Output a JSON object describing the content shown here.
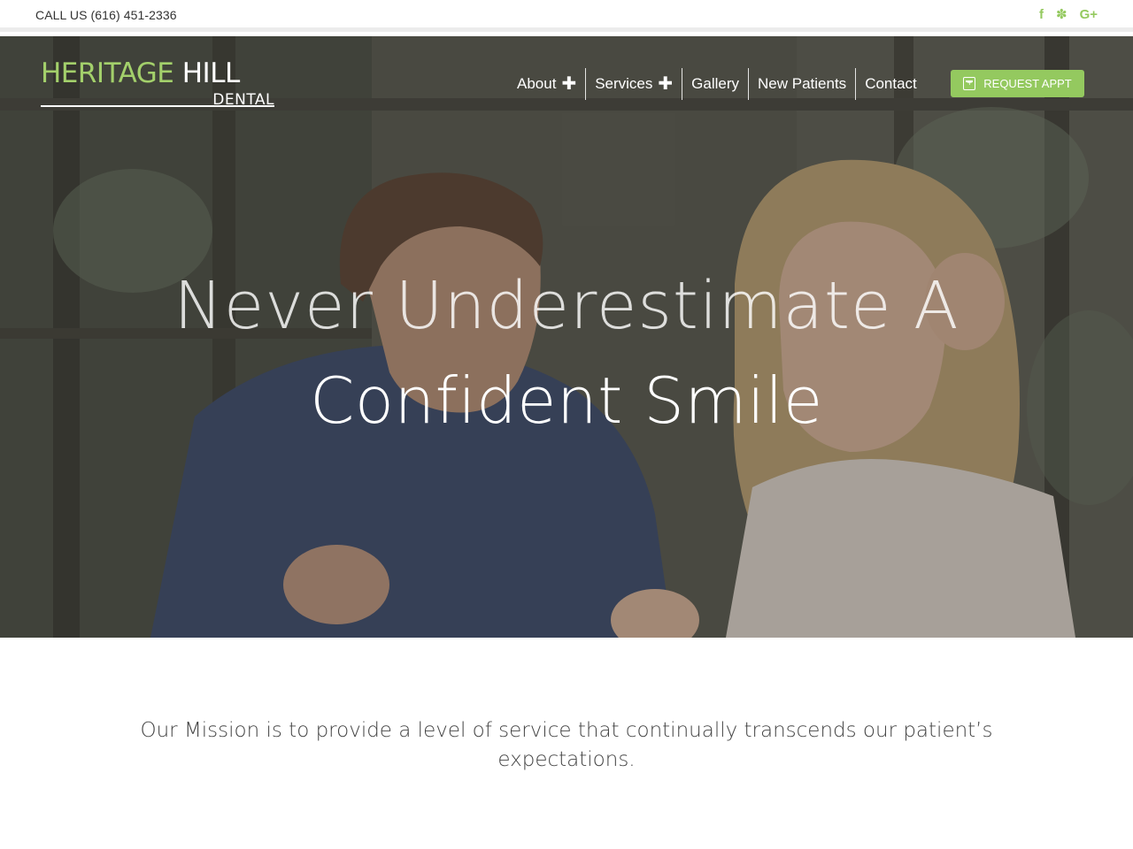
{
  "topbar": {
    "phone": "CALL US (616) 451-2336",
    "social": [
      {
        "icon": "facebook-icon",
        "glyph": "f"
      },
      {
        "icon": "yelp-icon",
        "glyph": "✽"
      },
      {
        "icon": "google-plus-icon",
        "glyph": "G+"
      }
    ]
  },
  "logo": {
    "word1": "HERITAGE",
    "word2": "HILL",
    "sub": "DENTAL"
  },
  "nav": {
    "items": [
      {
        "label": "About",
        "has_submenu": true
      },
      {
        "label": "Services",
        "has_submenu": true
      },
      {
        "label": "Gallery",
        "has_submenu": false
      },
      {
        "label": "New Patients",
        "has_submenu": false
      },
      {
        "label": "Contact",
        "has_submenu": false
      }
    ],
    "plus_glyph": "✚"
  },
  "cta": {
    "label": "REQUEST APPT",
    "icon": "calendar-plus-icon"
  },
  "hero": {
    "headline_line1": "Never Underestimate A",
    "headline_line2": "Confident Smile"
  },
  "mission": {
    "text": "Our Mission is to provide a level of service that continually transcends our patient’s expectations."
  },
  "colors": {
    "accent": "#94c95f",
    "logo_green": "#a3d06b",
    "text_dark": "#333333"
  }
}
